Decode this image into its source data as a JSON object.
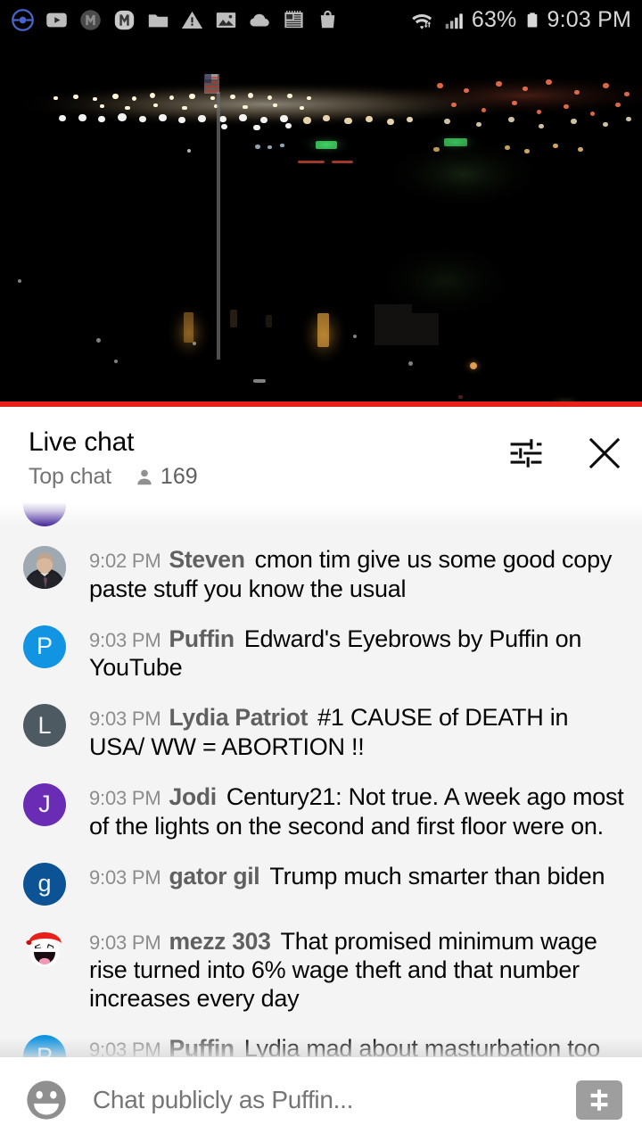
{
  "statusbar": {
    "left_icons": [
      {
        "name": "pokemon-go-icon"
      },
      {
        "name": "youtube-icon"
      },
      {
        "name": "m-badge-dark-icon"
      },
      {
        "name": "m-badge-light-icon"
      },
      {
        "name": "folder-icon"
      },
      {
        "name": "warning-triangle-icon"
      },
      {
        "name": "photo-icon"
      },
      {
        "name": "cloud-icon"
      },
      {
        "name": "news-icon"
      },
      {
        "name": "shopping-bag-icon"
      }
    ],
    "wifi_icon": "wifi-icon",
    "signal_icon": "cellular-signal-icon",
    "battery_percent": "63%",
    "battery_icon": "battery-icon",
    "clock": "9:03 PM"
  },
  "video": {
    "name": "live-video-player",
    "description": "night cityscape with flagpole",
    "progress_color": "#e62117",
    "progress_percent": 100
  },
  "chat_header": {
    "title": "Live chat",
    "mode": "Top chat",
    "viewer_count": "169",
    "person_icon": "person-icon",
    "settings_icon": "chat-settings-icon",
    "close_icon": "close-icon"
  },
  "messages": [
    {
      "id": "msg-clipped",
      "clipped": true,
      "timestamp": "",
      "author": "",
      "text": "",
      "avatar": {
        "type": "letter",
        "letter": "",
        "color": "#4b2e9e"
      }
    },
    {
      "id": "msg-steven",
      "timestamp": "9:02 PM",
      "author": "Steven",
      "text": "cmon tim give us some good copy paste stuff you know the usual",
      "avatar": {
        "type": "photo-suit-man",
        "letter": "",
        "color": "#9aa4ad"
      }
    },
    {
      "id": "msg-puffin-1",
      "timestamp": "9:03 PM",
      "author": "Puffin",
      "text": "Edward's Eyebrows by Puffin on YouTube",
      "avatar": {
        "type": "letter",
        "letter": "P",
        "color": "#1195e3"
      }
    },
    {
      "id": "msg-lydia-patriot",
      "timestamp": "9:03 PM",
      "author": "Lydia Patriot",
      "text": "#1 CAUSE of DEATH in USA/ WW = ABORTION !!",
      "avatar": {
        "type": "letter",
        "letter": "L",
        "color": "#4e5a61"
      }
    },
    {
      "id": "msg-jodi",
      "timestamp": "9:03 PM",
      "author": "Jodi",
      "text": "Century21: Not true. A week ago most of the lights on the second and first floor were on.",
      "avatar": {
        "type": "letter",
        "letter": "J",
        "color": "#6a2cb5"
      }
    },
    {
      "id": "msg-gator-gil",
      "timestamp": "9:03 PM",
      "author": "gator gil",
      "text": "Trump much smarter than biden",
      "avatar": {
        "type": "letter",
        "letter": "g",
        "color": "#0b5394"
      }
    },
    {
      "id": "msg-mezz-303",
      "timestamp": "9:03 PM",
      "author": "mezz 303",
      "text": "That promised minimum wage rise turned into 6% wage theft and that number increases every day",
      "avatar": {
        "type": "awesome-face-red-cap",
        "letter": "",
        "color": "#ffffff"
      }
    },
    {
      "id": "msg-puffin-2",
      "timestamp": "9:03 PM",
      "author": "Puffin",
      "text": "Lydia mad about masturbation too",
      "avatar": {
        "type": "letter",
        "letter": "P",
        "color": "#1195e3"
      }
    }
  ],
  "input_bar": {
    "emoji_icon": "emoji-face-icon",
    "placeholder": "Chat publicly as Puffin...",
    "value": "",
    "superchat_icon": "super-chat-dollar-icon"
  }
}
